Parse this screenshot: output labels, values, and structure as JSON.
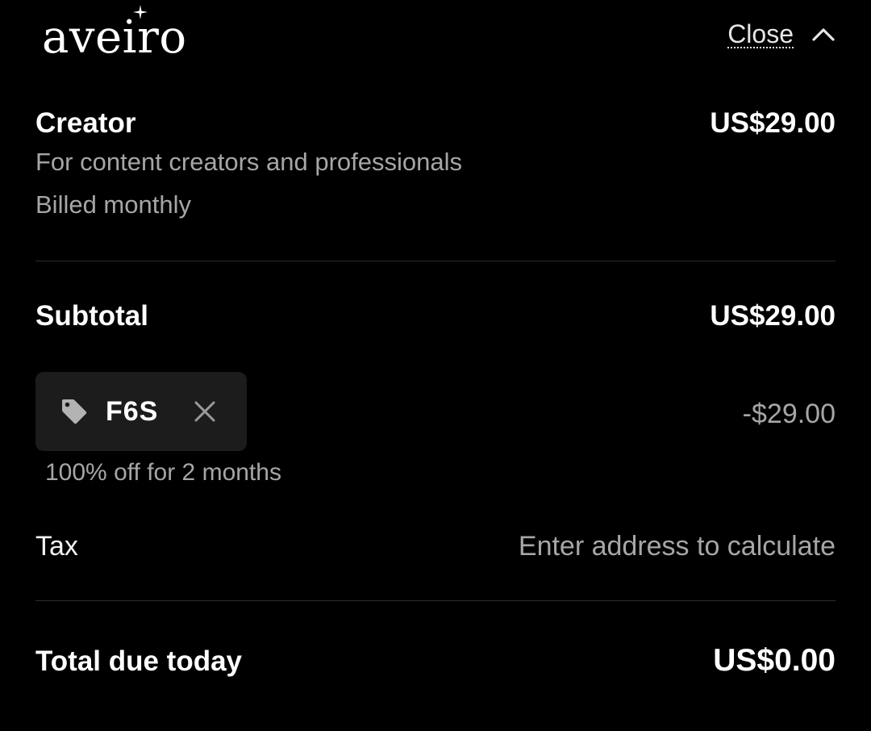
{
  "header": {
    "logo_text": "aveiro",
    "close_label": "Close",
    "chevron_icon": "chevron-up-icon",
    "star_icon": "sparkle-icon"
  },
  "plan": {
    "name": "Creator",
    "price": "US$29.00",
    "description": "For content creators and professionals",
    "billing": "Billed monthly"
  },
  "subtotal": {
    "label": "Subtotal",
    "value": "US$29.00"
  },
  "promo": {
    "icon": "tag-icon",
    "code": "F6S",
    "remove_icon": "close-x-icon",
    "discount": "-$29.00",
    "note": "100% off for 2 months"
  },
  "tax": {
    "label": "Tax",
    "value": "Enter address to calculate"
  },
  "total": {
    "label": "Total due today",
    "value": "US$0.00"
  },
  "colors": {
    "background": "#000000",
    "primary_text": "#ffffff",
    "secondary_text": "#a6a6a6",
    "chip_background": "#1c1c1c",
    "divider": "#2b2b2b"
  }
}
